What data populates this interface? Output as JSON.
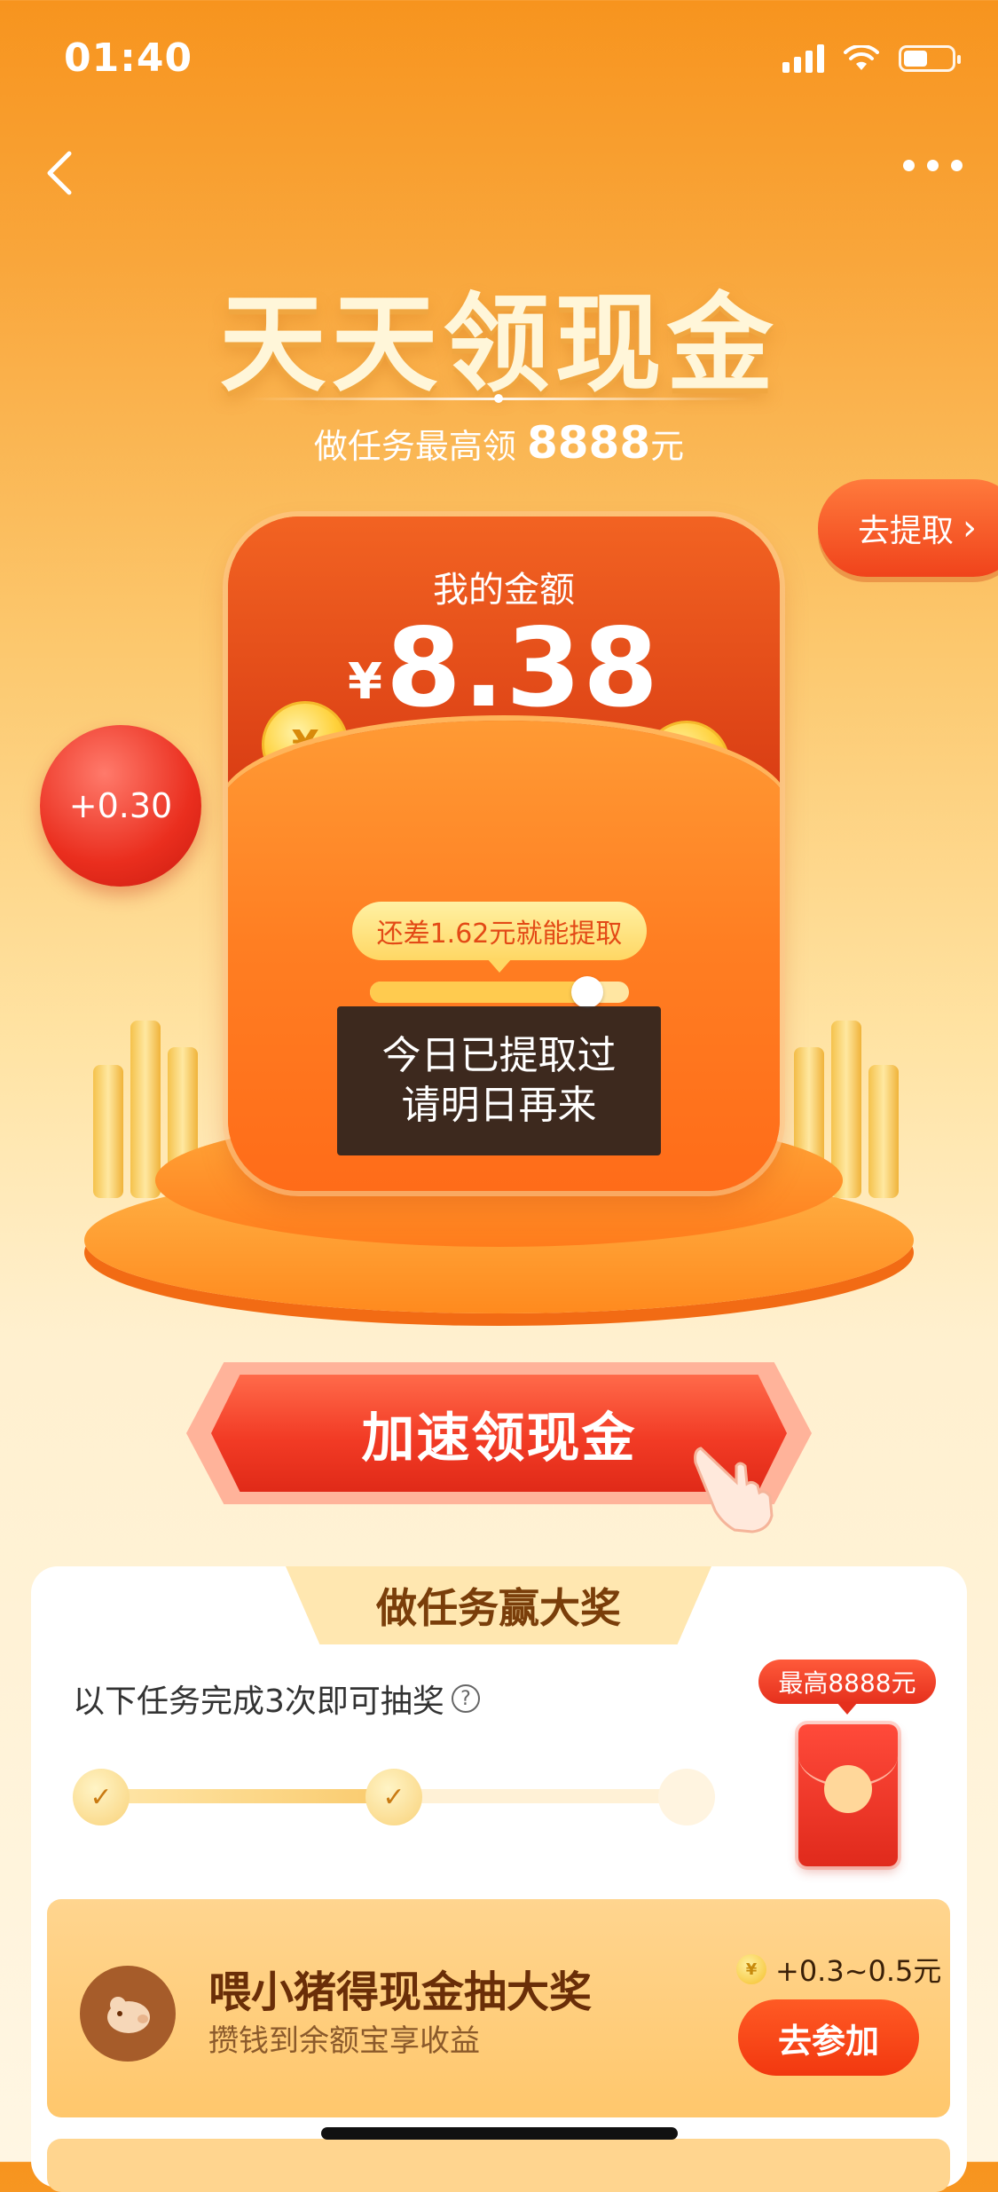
{
  "status": {
    "time": "01:40"
  },
  "nav": {
    "back": "back",
    "more": "more"
  },
  "header": {
    "title": "天天领现金",
    "subtitle_prefix": "做任务最高领",
    "subtitle_amount": "8888",
    "subtitle_suffix": "元"
  },
  "withdraw": {
    "label": "去提取"
  },
  "bubble": {
    "value": "+0.30"
  },
  "envelope": {
    "label": "我的金额",
    "currency": "¥",
    "amount": "8.38",
    "need_text": "还差1.62元就能提取",
    "progress": 0.84
  },
  "toast": {
    "line1": "今日已提取过",
    "line2": "请明日再来"
  },
  "cta": {
    "label": "加速领现金"
  },
  "task": {
    "header": "做任务赢大奖",
    "desc": "以下任务完成3次即可抽奖",
    "help": "?",
    "steps_total": 3,
    "steps_done": 2,
    "prize_tag": "最高8888元"
  },
  "subtask": {
    "title": "喂小猪得现金抽大奖",
    "desc": "攒钱到余额宝享收益",
    "reward": "+0.3~0.5元",
    "button": "去参加"
  },
  "colors": {
    "brand_orange": "#F7941E",
    "cta_red": "#F23B25",
    "text_brown": "#7A3E0A"
  },
  "icons": [
    "back-chevron-icon",
    "more-dots-icon",
    "signal-icon",
    "wifi-icon",
    "battery-icon",
    "coin-icon",
    "hand-pointer-icon",
    "help-icon",
    "check-icon",
    "pig-icon",
    "red-packet-icon"
  ]
}
